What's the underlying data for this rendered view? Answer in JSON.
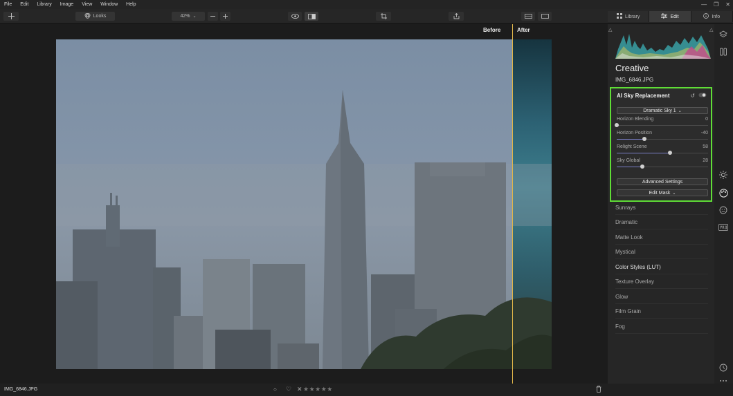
{
  "menu": [
    "File",
    "Edit",
    "Library",
    "Image",
    "View",
    "Window",
    "Help"
  ],
  "toolbar": {
    "looks_label": "Looks",
    "zoom_value": "42%"
  },
  "tabs": [
    {
      "label": "Library",
      "icon": "grid-icon"
    },
    {
      "label": "Edit",
      "icon": "sliders-icon"
    },
    {
      "label": "Info",
      "icon": "info-icon"
    }
  ],
  "canvas": {
    "before_label": "Before",
    "after_label": "After"
  },
  "panel": {
    "title": "Creative",
    "file_name": "IMG_6846.JPG",
    "tool": {
      "title": "AI Sky Replacement",
      "sky_select": "Dramatic Sky 1",
      "sliders": [
        {
          "label": "Horizon Blending",
          "value": "0",
          "fraction": 0.0
        },
        {
          "label": "Horizon Position",
          "value": "-40",
          "fraction": 0.3
        },
        {
          "label": "Relight Scene",
          "value": "58",
          "fraction": 0.58
        },
        {
          "label": "Sky Global",
          "value": "28",
          "fraction": 0.28
        }
      ],
      "advanced_label": "Advanced Settings",
      "edit_mask_label": "Edit Mask"
    },
    "tools": [
      "Sunrays",
      "Dramatic",
      "Matte Look",
      "Mystical",
      "Color Styles (LUT)",
      "Texture Overlay",
      "Glow",
      "Film Grain",
      "Fog"
    ]
  },
  "status": {
    "file_name": "IMG_6846.JPG",
    "rating": "★★★★★"
  },
  "colors": {
    "highlight": "#5fdd36",
    "divider": "#e0b64a"
  }
}
